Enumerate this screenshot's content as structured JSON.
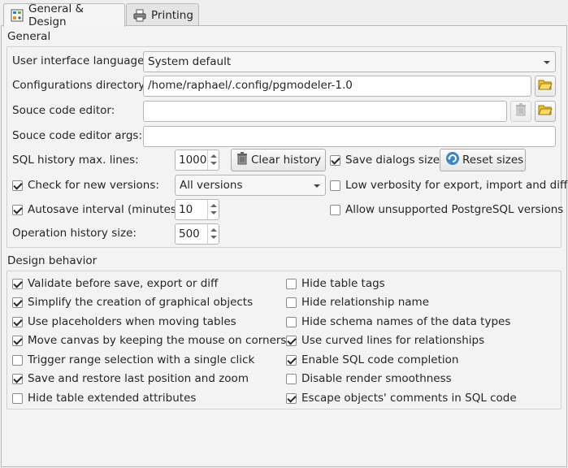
{
  "tabs": [
    {
      "label": "General & Design",
      "icon": "settings-design-icon",
      "active": true
    },
    {
      "label": "Printing",
      "icon": "printer-icon",
      "active": false
    }
  ],
  "general": {
    "title": "General",
    "ui_language_label": "User interface language:",
    "ui_language_value": "System default",
    "config_dir_label": "Configurations directory:",
    "config_dir_value": "/home/raphael/.config/pgmodeler-1.0",
    "source_editor_label": "Souce code editor:",
    "source_editor_value": "",
    "source_editor_args_label": "Souce code editor args:",
    "source_editor_args_value": "",
    "sql_history_label": "SQL history max. lines:",
    "sql_history_value": "1000",
    "clear_history_label": "Clear history",
    "save_dialogs_label": "Save dialogs sizes",
    "save_dialogs_checked": true,
    "reset_sizes_label": "Reset sizes",
    "check_versions_label": "Check for new versions:",
    "check_versions_checked": true,
    "versions_value": "All versions",
    "low_verbosity_label": "Low verbosity for export, import and diff",
    "low_verbosity_checked": false,
    "autosave_label": "Autosave interval (minutes):",
    "autosave_checked": true,
    "autosave_value": "10",
    "allow_unsupported_label": "Allow unsupported PostgreSQL versions",
    "allow_unsupported_checked": false,
    "op_history_label": "Operation history size:",
    "op_history_value": "500"
  },
  "design": {
    "title": "Design behavior",
    "left": [
      {
        "label": "Validate before save, export or diff",
        "checked": true
      },
      {
        "label": "Simplify the creation of graphical objects",
        "checked": true
      },
      {
        "label": "Use placeholders when moving tables",
        "checked": true
      },
      {
        "label": "Move canvas by keeping the mouse on corners",
        "checked": true
      },
      {
        "label": "Trigger range selection with a single click",
        "checked": false
      },
      {
        "label": "Save and restore last position and zoom",
        "checked": true
      },
      {
        "label": "Hide table extended attributes",
        "checked": false
      }
    ],
    "right": [
      {
        "label": "Hide table tags",
        "checked": false
      },
      {
        "label": "Hide relationship name",
        "checked": false
      },
      {
        "label": "Hide schema names of the data types",
        "checked": false
      },
      {
        "label": "Use curved lines for relationships",
        "checked": true
      },
      {
        "label": "Enable SQL code completion",
        "checked": true
      },
      {
        "label": "Disable render smoothness",
        "checked": false
      },
      {
        "label": "Escape objects' comments in SQL code",
        "checked": true
      }
    ]
  }
}
